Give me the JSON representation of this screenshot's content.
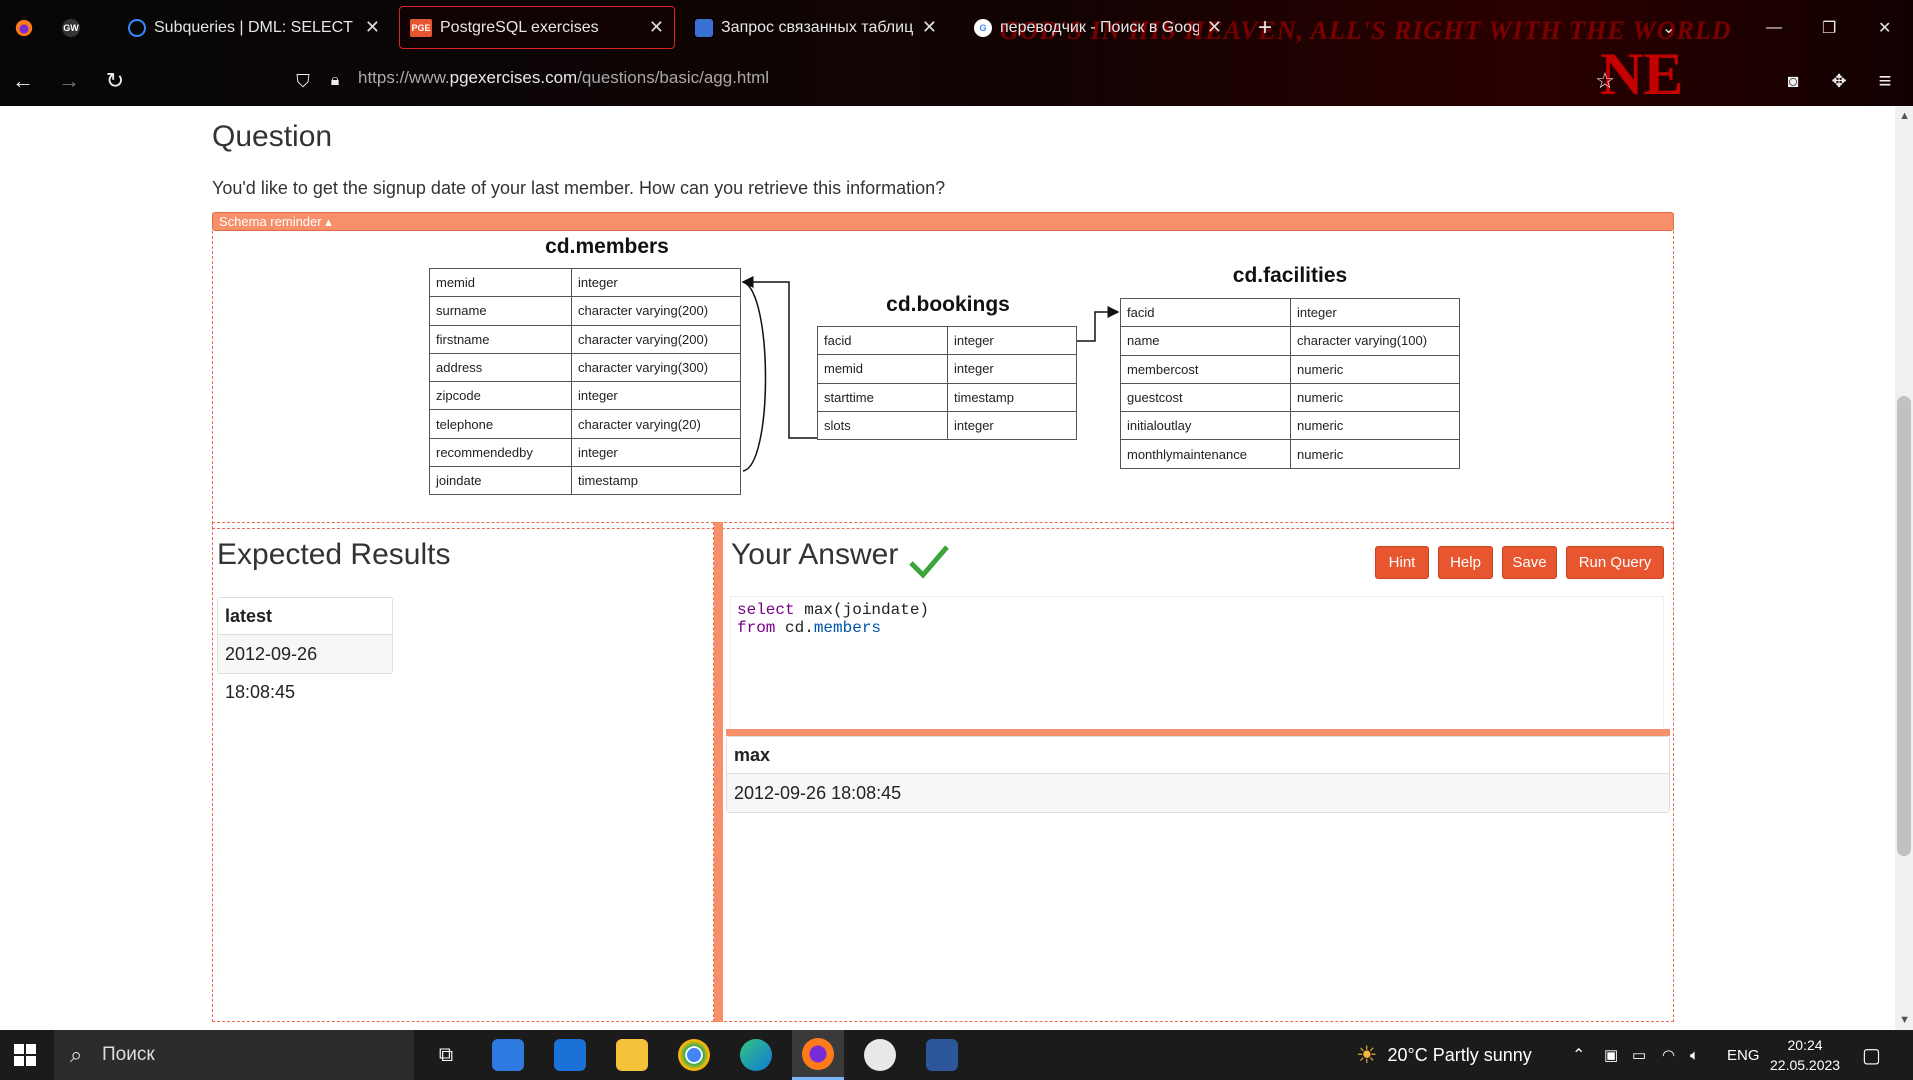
{
  "browser": {
    "tabs": [
      {
        "label": "Subqueries | DML: SELECT State",
        "active": false
      },
      {
        "label": "PostgreSQL exercises",
        "active": true
      },
      {
        "label": "Запрос связанных таблиц - Po",
        "active": false
      },
      {
        "label": "переводчик - Поиск в Google",
        "active": false
      }
    ],
    "pinned_tab_label": "GW",
    "favicon_pge": "PGE",
    "url_prefix": "https://www.",
    "url_domain": "pgexercises.com",
    "url_path": "/questions/basic/agg.html",
    "theme_text": "GOD'S IN HIS HEAVEN, ALL'S RIGHT WITH THE WORLD",
    "theme_logo": "NE"
  },
  "question": {
    "title": "Question",
    "text": "You'd like to get the signup date of your last member. How can you retrieve this information?"
  },
  "schema": {
    "reminder_label": "Schema reminder ▴",
    "members": {
      "title": "cd.members",
      "rows": [
        [
          "memid",
          "integer"
        ],
        [
          "surname",
          "character varying(200)"
        ],
        [
          "firstname",
          "character varying(200)"
        ],
        [
          "address",
          "character varying(300)"
        ],
        [
          "zipcode",
          "integer"
        ],
        [
          "telephone",
          "character varying(20)"
        ],
        [
          "recommendedby",
          "integer"
        ],
        [
          "joindate",
          "timestamp"
        ]
      ]
    },
    "bookings": {
      "title": "cd.bookings",
      "rows": [
        [
          "facid",
          "integer"
        ],
        [
          "memid",
          "integer"
        ],
        [
          "starttime",
          "timestamp"
        ],
        [
          "slots",
          "integer"
        ]
      ]
    },
    "facilities": {
      "title": "cd.facilities",
      "rows": [
        [
          "facid",
          "integer"
        ],
        [
          "name",
          "character varying(100)"
        ],
        [
          "membercost",
          "numeric"
        ],
        [
          "guestcost",
          "numeric"
        ],
        [
          "initialoutlay",
          "numeric"
        ],
        [
          "monthlymaintenance",
          "numeric"
        ]
      ]
    }
  },
  "expected": {
    "title": "Expected Results",
    "column": "latest",
    "value": "2012-09-26 18:08:45"
  },
  "answer": {
    "title": "Your Answer",
    "buttons": {
      "hint": "Hint",
      "help": "Help",
      "save": "Save",
      "run": "Run Query"
    },
    "code": {
      "kw1": "select",
      "line1_rest": " max(joindate)",
      "kw2": "from",
      "line2_mid": " cd.",
      "line2_prop": "members"
    },
    "result_column": "max",
    "result_value": "2012-09-26 18:08:45"
  },
  "taskbar": {
    "search_placeholder": "Поиск",
    "weather": "20°C  Partly sunny",
    "lang": "ENG",
    "time": "20:24",
    "date": "22.05.2023"
  },
  "colors": {
    "accent": "#f78f6b",
    "button": "#e8562f",
    "chrome_bg": "#0a0a0a",
    "taskbar_bg": "#1b1b1b"
  }
}
